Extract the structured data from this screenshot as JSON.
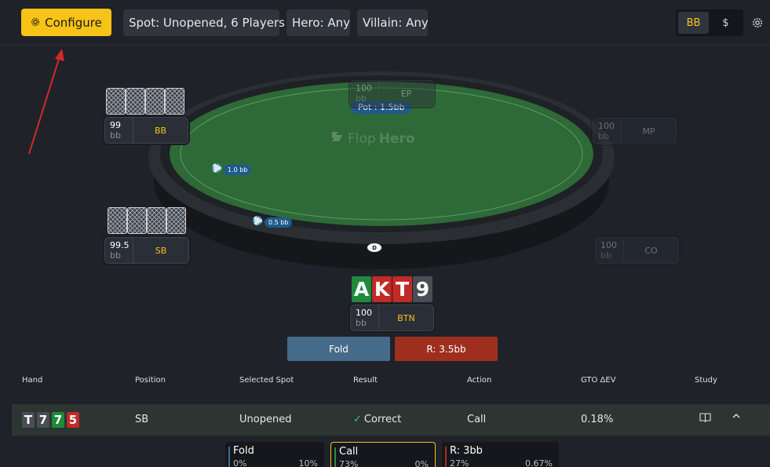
{
  "toolbar": {
    "configure_label": "Configure",
    "spot": "Spot: Unopened, 6 Players",
    "hero": "Hero: Any",
    "villain": "Villain: Any",
    "units": [
      "BB",
      "$"
    ],
    "active_unit": "BB"
  },
  "table": {
    "pot": "Pot : 1.5bb",
    "watermark_a": "Flop",
    "watermark_b": "Hero",
    "dealer": "D",
    "bets": {
      "bb": "1.0 bb",
      "sb": "0.5 bb"
    },
    "seats": {
      "bb": {
        "stack": "99",
        "unit": "bb",
        "position": "BB"
      },
      "sb": {
        "stack": "99.5",
        "unit": "bb",
        "position": "SB"
      },
      "ep": {
        "stack": "100",
        "unit": "bb",
        "position": "EP"
      },
      "mp": {
        "stack": "100",
        "unit": "bb",
        "position": "MP"
      },
      "co": {
        "stack": "100",
        "unit": "bb",
        "position": "CO"
      },
      "btn": {
        "stack": "100",
        "unit": "bb",
        "position": "BTN"
      }
    },
    "hero_cards": [
      "A",
      "K",
      "T",
      "9"
    ]
  },
  "actions": {
    "fold": "Fold",
    "raise": "R: 3.5bb"
  },
  "results": {
    "headers": [
      "Hand",
      "Position",
      "Selected Spot",
      "Result",
      "Action",
      "GTO ΔEV",
      "Study"
    ],
    "row": {
      "hand": [
        "T",
        "7",
        "7",
        "5"
      ],
      "position": "SB",
      "spot": "Unopened",
      "result": "Correct",
      "action": "Call",
      "ev": "0.18%"
    }
  },
  "stats": [
    {
      "label": "Fold",
      "left": "0%",
      "right": "10%"
    },
    {
      "label": "Call",
      "left": "73%",
      "right": "0%"
    },
    {
      "label": "R: 3bb",
      "left": "27%",
      "right": "0.67%"
    }
  ],
  "colors": {
    "accent": "#f7c316",
    "felt": "#2e6a37",
    "fold": "#456a8a",
    "raise": "#9e2f1f",
    "club": "#1f8a3b",
    "diamond": "#2b64c4",
    "heart": "#c12a26",
    "spade": "#4a4d53"
  }
}
